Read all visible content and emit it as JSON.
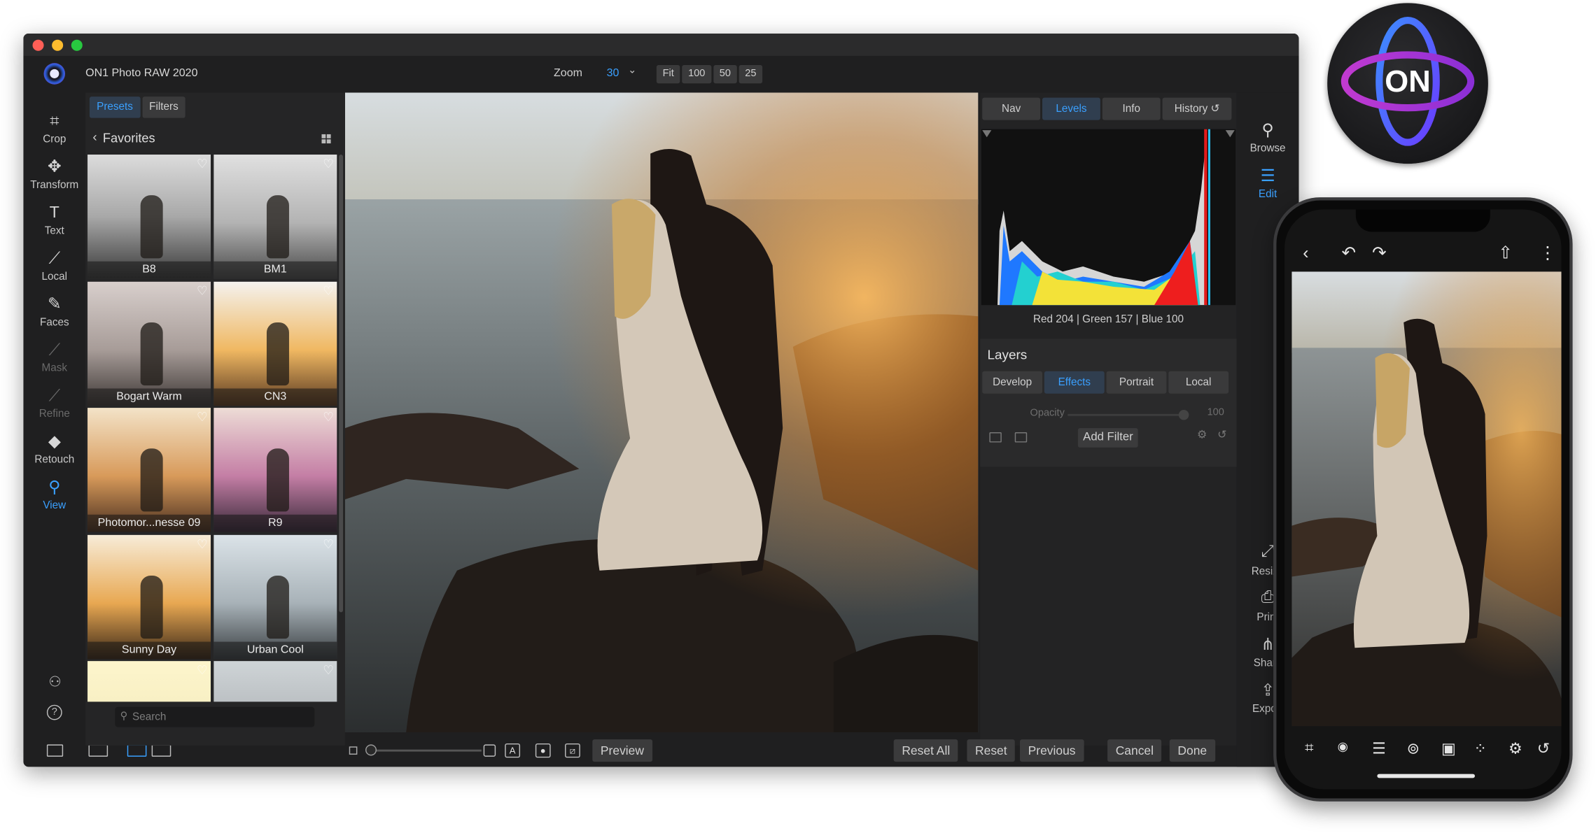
{
  "app": {
    "name": "ON1 Photo RAW 2020"
  },
  "zoom": {
    "label": "Zoom",
    "value": "30",
    "buttons": [
      "Fit",
      "100",
      "50",
      "25"
    ]
  },
  "left_tools": [
    {
      "label": "Crop",
      "icon": "crop-icon",
      "glyph": "⌗",
      "state": "normal"
    },
    {
      "label": "Transform",
      "icon": "move-icon",
      "glyph": "✥",
      "state": "normal"
    },
    {
      "label": "Text",
      "icon": "text-icon",
      "glyph": "T",
      "state": "normal"
    },
    {
      "label": "Local",
      "icon": "brush-icon",
      "glyph": "⟋",
      "state": "normal"
    },
    {
      "label": "Faces",
      "icon": "faces-icon",
      "glyph": "✎",
      "state": "normal"
    },
    {
      "label": "Mask",
      "icon": "mask-icon",
      "glyph": "⟋",
      "state": "dim"
    },
    {
      "label": "Refine",
      "icon": "refine-icon",
      "glyph": "⟋",
      "state": "dim"
    },
    {
      "label": "Retouch",
      "icon": "retouch-icon",
      "glyph": "◆",
      "state": "normal"
    },
    {
      "label": "View",
      "icon": "view-icon",
      "glyph": "⚲",
      "state": "active"
    }
  ],
  "presets_panel": {
    "tabs": [
      "Presets",
      "Filters"
    ],
    "active_tab": "Presets",
    "category": "Favorites",
    "search_placeholder": "Search",
    "presets": [
      "B8",
      "BM1",
      "Bogart Warm",
      "CN3",
      "Photomor...nesse 09",
      "R9",
      "Sunny Day",
      "Urban Cool",
      "",
      ""
    ]
  },
  "right_panel": {
    "tabs": [
      "Nav",
      "Levels",
      "Info",
      "History"
    ],
    "active_tab": "Levels",
    "rgb_readout": "Red 204 | Green 157 | Blue 100",
    "layers_title": "Layers",
    "layer_tabs": [
      "Develop",
      "Effects",
      "Portrait",
      "Local"
    ],
    "active_layer_tab": "Effects",
    "opacity_label": "Opacity",
    "opacity_value": "100",
    "opacity_level": 1.0,
    "add_filter_label": "Add Filter"
  },
  "right_tools": [
    {
      "label": "Browse",
      "icon": "browse-icon"
    },
    {
      "label": "Edit",
      "icon": "edit-sliders-icon"
    },
    {
      "label": "Resize",
      "icon": "resize-icon"
    },
    {
      "label": "Print",
      "icon": "print-icon"
    },
    {
      "label": "Share",
      "icon": "share-icon"
    },
    {
      "label": "Export",
      "icon": "export-icon"
    }
  ],
  "bottom_bar": {
    "preview_label": "Preview",
    "reset_all_label": "Reset All",
    "reset_label": "Reset",
    "previous_label": "Previous",
    "cancel_label": "Cancel",
    "done_label": "Done"
  },
  "colors": {
    "accent": "#3aa0ff",
    "panel": "#252526",
    "button": "#3b3b3c",
    "active_tab_bg": "#303e4f"
  }
}
